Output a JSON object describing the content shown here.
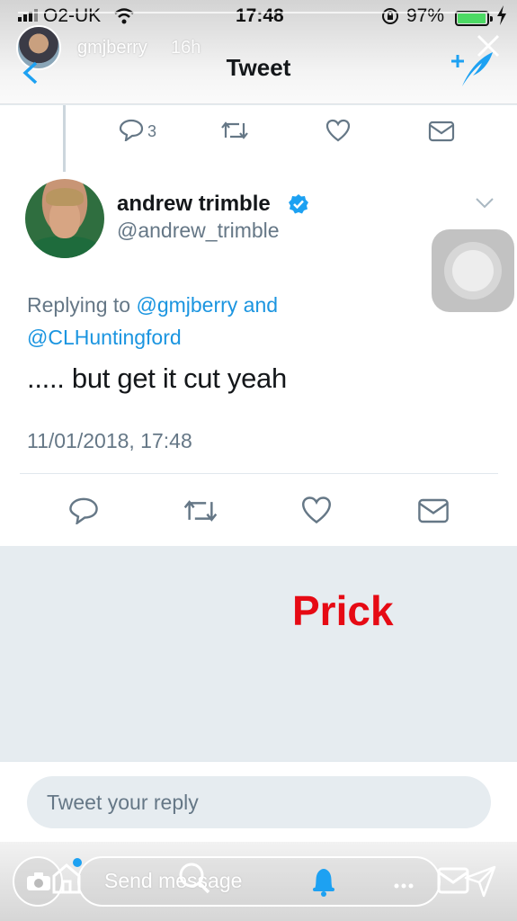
{
  "status_bar": {
    "carrier": "O2-UK",
    "time": "17:48",
    "battery_percent": "97%",
    "battery_level": 0.97
  },
  "story": {
    "username": "gmjberry",
    "age": "16h"
  },
  "header": {
    "title": "Tweet"
  },
  "previous_tweet": {
    "reply_count": "3"
  },
  "tweet": {
    "author_name": "andrew trimble",
    "author_handle": "@andrew_trimble",
    "verified": true,
    "replying_prefix": "Replying to",
    "reply_to_1": "@gmjberry",
    "reply_joiner": "and",
    "reply_to_2": "@CLHuntingford",
    "text": "..... but get it cut yeah",
    "timestamp": "11/01/2018, 17:48"
  },
  "overlay": {
    "text": "Prick",
    "color": "#e60a14"
  },
  "composer": {
    "placeholder": "Tweet your reply"
  },
  "story_footer": {
    "send_message_label": "Send message"
  },
  "icons": [
    "back-icon",
    "compose-icon",
    "close-icon",
    "reply-icon",
    "retweet-icon",
    "like-icon",
    "dm-icon",
    "verified-icon",
    "chevron-down-icon",
    "camera-icon",
    "home-icon",
    "search-icon",
    "bell-icon",
    "more-icon",
    "mail-icon",
    "send-icon"
  ],
  "colors": {
    "accent": "#1da1f2",
    "link": "#1b95e0",
    "muted": "#657786"
  }
}
